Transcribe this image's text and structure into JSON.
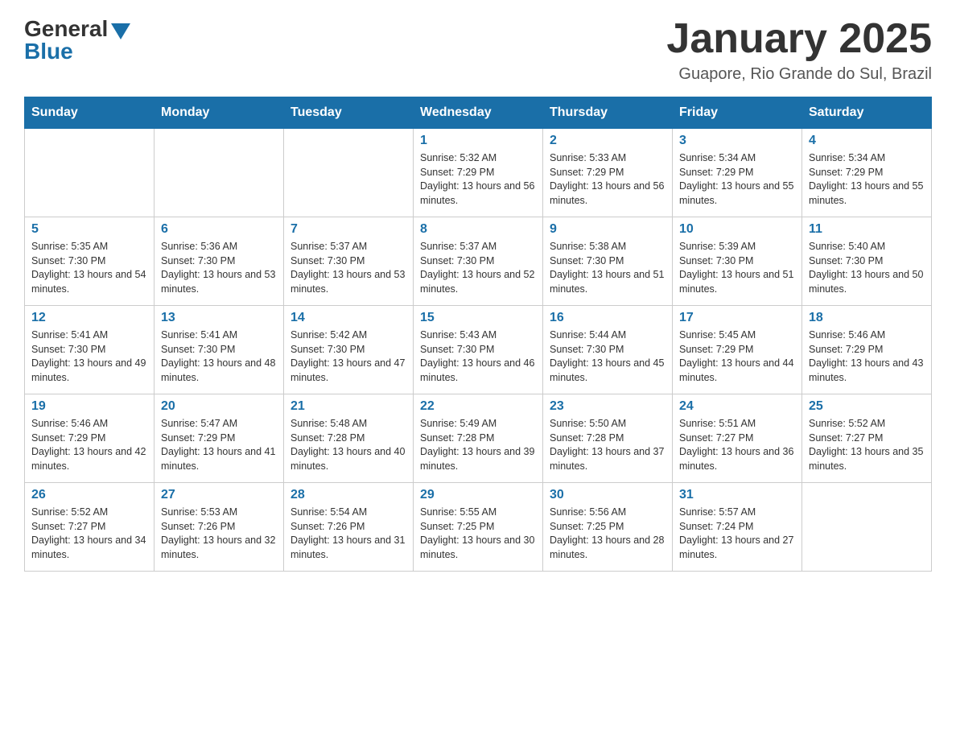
{
  "logo": {
    "general": "General",
    "blue": "Blue"
  },
  "title": "January 2025",
  "subtitle": "Guapore, Rio Grande do Sul, Brazil",
  "headers": [
    "Sunday",
    "Monday",
    "Tuesday",
    "Wednesday",
    "Thursday",
    "Friday",
    "Saturday"
  ],
  "weeks": [
    [
      {
        "day": "",
        "info": ""
      },
      {
        "day": "",
        "info": ""
      },
      {
        "day": "",
        "info": ""
      },
      {
        "day": "1",
        "info": "Sunrise: 5:32 AM\nSunset: 7:29 PM\nDaylight: 13 hours and 56 minutes."
      },
      {
        "day": "2",
        "info": "Sunrise: 5:33 AM\nSunset: 7:29 PM\nDaylight: 13 hours and 56 minutes."
      },
      {
        "day": "3",
        "info": "Sunrise: 5:34 AM\nSunset: 7:29 PM\nDaylight: 13 hours and 55 minutes."
      },
      {
        "day": "4",
        "info": "Sunrise: 5:34 AM\nSunset: 7:29 PM\nDaylight: 13 hours and 55 minutes."
      }
    ],
    [
      {
        "day": "5",
        "info": "Sunrise: 5:35 AM\nSunset: 7:30 PM\nDaylight: 13 hours and 54 minutes."
      },
      {
        "day": "6",
        "info": "Sunrise: 5:36 AM\nSunset: 7:30 PM\nDaylight: 13 hours and 53 minutes."
      },
      {
        "day": "7",
        "info": "Sunrise: 5:37 AM\nSunset: 7:30 PM\nDaylight: 13 hours and 53 minutes."
      },
      {
        "day": "8",
        "info": "Sunrise: 5:37 AM\nSunset: 7:30 PM\nDaylight: 13 hours and 52 minutes."
      },
      {
        "day": "9",
        "info": "Sunrise: 5:38 AM\nSunset: 7:30 PM\nDaylight: 13 hours and 51 minutes."
      },
      {
        "day": "10",
        "info": "Sunrise: 5:39 AM\nSunset: 7:30 PM\nDaylight: 13 hours and 51 minutes."
      },
      {
        "day": "11",
        "info": "Sunrise: 5:40 AM\nSunset: 7:30 PM\nDaylight: 13 hours and 50 minutes."
      }
    ],
    [
      {
        "day": "12",
        "info": "Sunrise: 5:41 AM\nSunset: 7:30 PM\nDaylight: 13 hours and 49 minutes."
      },
      {
        "day": "13",
        "info": "Sunrise: 5:41 AM\nSunset: 7:30 PM\nDaylight: 13 hours and 48 minutes."
      },
      {
        "day": "14",
        "info": "Sunrise: 5:42 AM\nSunset: 7:30 PM\nDaylight: 13 hours and 47 minutes."
      },
      {
        "day": "15",
        "info": "Sunrise: 5:43 AM\nSunset: 7:30 PM\nDaylight: 13 hours and 46 minutes."
      },
      {
        "day": "16",
        "info": "Sunrise: 5:44 AM\nSunset: 7:30 PM\nDaylight: 13 hours and 45 minutes."
      },
      {
        "day": "17",
        "info": "Sunrise: 5:45 AM\nSunset: 7:29 PM\nDaylight: 13 hours and 44 minutes."
      },
      {
        "day": "18",
        "info": "Sunrise: 5:46 AM\nSunset: 7:29 PM\nDaylight: 13 hours and 43 minutes."
      }
    ],
    [
      {
        "day": "19",
        "info": "Sunrise: 5:46 AM\nSunset: 7:29 PM\nDaylight: 13 hours and 42 minutes."
      },
      {
        "day": "20",
        "info": "Sunrise: 5:47 AM\nSunset: 7:29 PM\nDaylight: 13 hours and 41 minutes."
      },
      {
        "day": "21",
        "info": "Sunrise: 5:48 AM\nSunset: 7:28 PM\nDaylight: 13 hours and 40 minutes."
      },
      {
        "day": "22",
        "info": "Sunrise: 5:49 AM\nSunset: 7:28 PM\nDaylight: 13 hours and 39 minutes."
      },
      {
        "day": "23",
        "info": "Sunrise: 5:50 AM\nSunset: 7:28 PM\nDaylight: 13 hours and 37 minutes."
      },
      {
        "day": "24",
        "info": "Sunrise: 5:51 AM\nSunset: 7:27 PM\nDaylight: 13 hours and 36 minutes."
      },
      {
        "day": "25",
        "info": "Sunrise: 5:52 AM\nSunset: 7:27 PM\nDaylight: 13 hours and 35 minutes."
      }
    ],
    [
      {
        "day": "26",
        "info": "Sunrise: 5:52 AM\nSunset: 7:27 PM\nDaylight: 13 hours and 34 minutes."
      },
      {
        "day": "27",
        "info": "Sunrise: 5:53 AM\nSunset: 7:26 PM\nDaylight: 13 hours and 32 minutes."
      },
      {
        "day": "28",
        "info": "Sunrise: 5:54 AM\nSunset: 7:26 PM\nDaylight: 13 hours and 31 minutes."
      },
      {
        "day": "29",
        "info": "Sunrise: 5:55 AM\nSunset: 7:25 PM\nDaylight: 13 hours and 30 minutes."
      },
      {
        "day": "30",
        "info": "Sunrise: 5:56 AM\nSunset: 7:25 PM\nDaylight: 13 hours and 28 minutes."
      },
      {
        "day": "31",
        "info": "Sunrise: 5:57 AM\nSunset: 7:24 PM\nDaylight: 13 hours and 27 minutes."
      },
      {
        "day": "",
        "info": ""
      }
    ]
  ]
}
